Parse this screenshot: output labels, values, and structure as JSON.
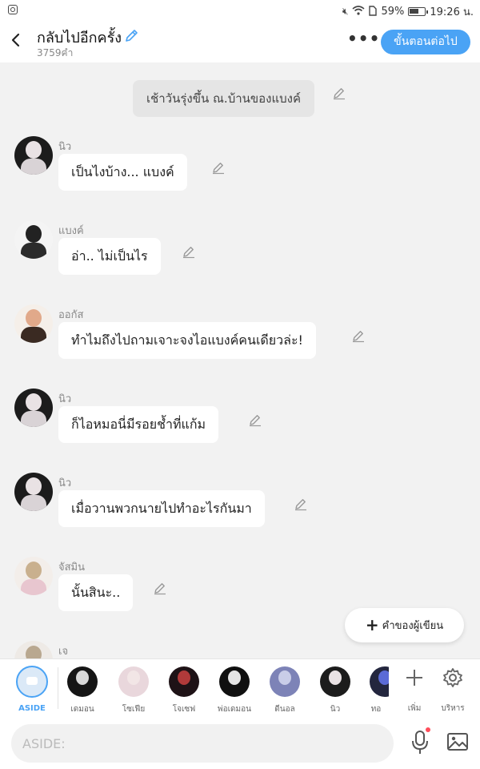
{
  "status_bar": {
    "battery": "59%",
    "time": "19:26 น."
  },
  "header": {
    "title": "กลับไปอีกครั้ง",
    "word_count": "3759คำ",
    "more_label": "•••",
    "next_button": "ขั้นตอนต่อไป"
  },
  "narration": "เช้าวันรุ่งขึ้น ณ.บ้านของแบงค์",
  "messages": [
    {
      "name": "นิว",
      "text": "เป็นไงบ้าง... แบงค์",
      "avatar_icon": "character-new-icon"
    },
    {
      "name": "แบงค์",
      "text": "อ่า.. ไม่เป็นไร",
      "avatar_icon": "character-bank-icon"
    },
    {
      "name": "ออกัส",
      "text": "ทำไมถึงไปถามเจาะจงไอแบงค์คนเดียวล่ะ!",
      "avatar_icon": "character-august-icon"
    },
    {
      "name": "นิว",
      "text": "ก็ไอหมอนี่มีรอยช้ำที่แก้ม",
      "avatar_icon": "character-new-icon"
    },
    {
      "name": "นิว",
      "text": "เมื่อวานพวกนายไปทำอะไรกันมา",
      "avatar_icon": "character-new-icon"
    },
    {
      "name": "จัสมิน",
      "text": "นั้นสินะ..",
      "avatar_icon": "character-jasmine-icon"
    },
    {
      "name": "เจ",
      "text": "",
      "avatar_icon": "character-j-icon"
    }
  ],
  "fab": {
    "plus": "+",
    "label": "คำของผู้เขียน"
  },
  "charbar": {
    "aside_label": "ASIDE",
    "characters": [
      "เดมอน",
      "โซเฟีย",
      "โจเซฟ",
      "พ่อเดมอน",
      "ดีนอล",
      "นิว",
      "ทอ"
    ],
    "add_label": "เพิ่ม",
    "manage_label": "บริหาร"
  },
  "input": {
    "placeholder": "ASIDE:",
    "value": ""
  },
  "colors": {
    "accent": "#4aa3f5",
    "background": "#f2f2f2",
    "bubble": "#ffffff",
    "notification_dot": "#ff4d5a"
  }
}
